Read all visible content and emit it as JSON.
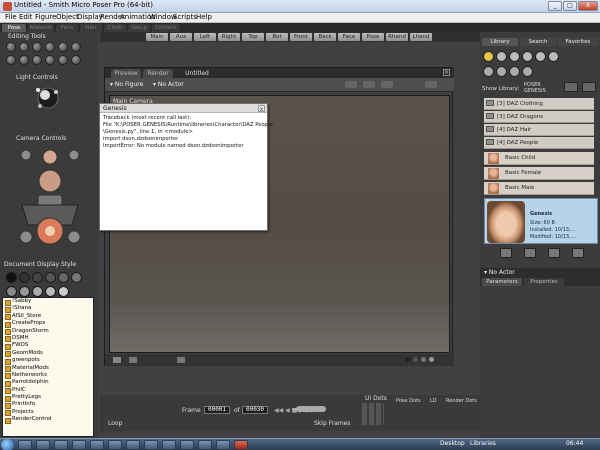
{
  "window": {
    "title": "Untitled - Smith Micro Poser Pro  (64-bit)",
    "controls": [
      "_",
      "□",
      "X"
    ]
  },
  "menubar": [
    "File",
    "Edit",
    "Figure",
    "Object",
    "Display",
    "Render",
    "Animation",
    "Window",
    "Scripts",
    "Help"
  ],
  "room_tabs": [
    {
      "label": "Pose",
      "active": true
    },
    {
      "label": "Material",
      "active": false
    },
    {
      "label": "Face",
      "active": false
    },
    {
      "label": "Hair",
      "active": false
    },
    {
      "label": "Cloth",
      "active": false
    },
    {
      "label": "Setup",
      "active": false
    },
    {
      "label": "Content",
      "active": false
    }
  ],
  "camera_views": [
    "Main",
    "Aux",
    "Left",
    "Right",
    "Top",
    "Bot",
    "Front",
    "Back",
    "Face",
    "Pose",
    "Rhand",
    "Lhand"
  ],
  "left_panel": {
    "editing_tools_label": "Editing Tools",
    "light_controls_label": "Light Controls",
    "camera_controls_label": "Camera Controls",
    "document_display_label": "Document Display Style",
    "scripts": [
      "!Sabby",
      "!Shana",
      "AlSil_Store",
      "CreateProps",
      "DragonStorm",
      "DSMH",
      "FWDS",
      "GeomMods",
      "greenpots",
      "MaterialMods",
      "Netherworks",
      "Parrotdolphin",
      "PhilC",
      "PrettyLegs",
      "PrintInfo",
      "Projects",
      "RenderControl"
    ]
  },
  "document": {
    "tabs": [
      "Preview",
      "Render",
      "Untitled"
    ],
    "figure_select": "No Figure",
    "actor_select": "No Actor",
    "camera_label": "Main Camera"
  },
  "dialog": {
    "title": "Genesis",
    "close": "x",
    "traceback": [
      "Traceback (most recent call last):",
      "  File \"K:\\POSER GENESIS\\Runtime\\libraries\\Character\\DAZ People",
      "\\Genesis.py\", line 1, in <module>",
      "    import dson.dzdsonimporter",
      "ImportError: No module named dson.dzdsonimporter"
    ]
  },
  "library": {
    "tabs": [
      "Library",
      "Search",
      "Favorites"
    ],
    "show_library_label": "Show Library:",
    "library_name": "POSER GENESIS",
    "folders": [
      {
        "label": "[3]  DAZ Clothing"
      },
      {
        "label": "[3]  DAZ Dragons"
      },
      {
        "label": "[4]  DAZ Hair"
      },
      {
        "label": "[4]  DAZ People"
      }
    ],
    "figures": [
      "Basic Child",
      "Basic Female",
      "Basic Male"
    ],
    "preview": {
      "name": "Genesis",
      "size": "Size: 60 B",
      "installed": "Installed: 10/13,...",
      "modified": "Modified: 10/13,..."
    }
  },
  "parameters": {
    "actor": "No Actor",
    "tabs": [
      "Parameters",
      "Properties"
    ]
  },
  "animation": {
    "frame_label": "Frame",
    "frame_value": "00001",
    "of_label": "of",
    "total_frames": "00030",
    "loop_label": "Loop",
    "skip_frames_label": "Skip Frames",
    "ui_dots_label": "UI Dots",
    "pose_dots_label": "Pose Dots",
    "ld_label": "LD",
    "render_dots_label": "Render Dots"
  },
  "taskbar": {
    "desktop_label": "Desktop",
    "libraries_label": "Libraries",
    "clock": "06:44"
  },
  "colors": {
    "accent": "#b7d3ea",
    "panel": "#3c3c3c",
    "viewport": "#59524a"
  }
}
